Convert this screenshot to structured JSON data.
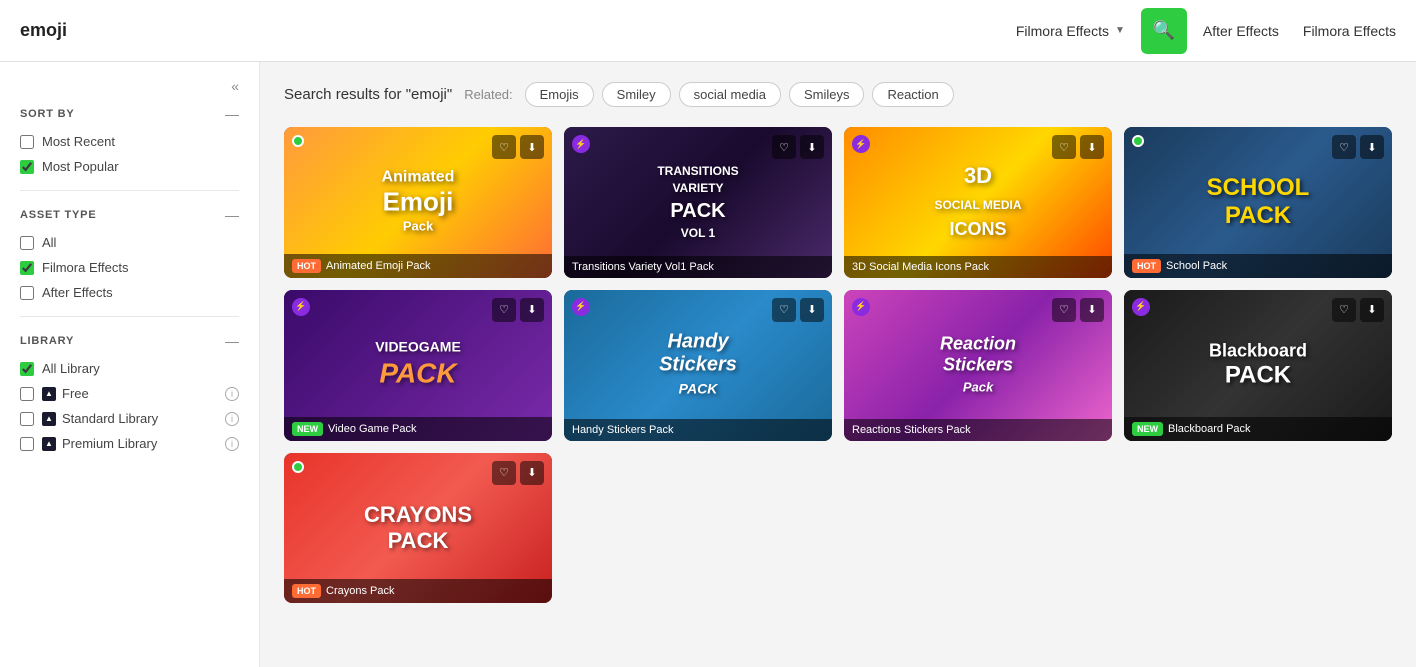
{
  "header": {
    "logo": "emoji",
    "dropdown_label": "Filmora Effects",
    "search_icon": "search",
    "nav_items": [
      {
        "label": "After Effects",
        "active": false
      },
      {
        "label": "Filmora Effects",
        "active": true
      }
    ]
  },
  "sidebar": {
    "collapse_icon": "«",
    "sort_by": {
      "title": "SORT BY",
      "options": [
        {
          "label": "Most Recent",
          "checked": false
        },
        {
          "label": "Most Popular",
          "checked": true
        }
      ]
    },
    "asset_type": {
      "title": "ASSET TYPE",
      "options": [
        {
          "label": "All",
          "checked": false
        },
        {
          "label": "Filmora Effects",
          "checked": true
        },
        {
          "label": "After Effects",
          "checked": false
        }
      ]
    },
    "library": {
      "title": "LIBRARY",
      "options": [
        {
          "label": "All Library",
          "checked": true,
          "has_shield": false,
          "has_info": false
        },
        {
          "label": "Free",
          "checked": false,
          "has_shield": true,
          "has_info": true
        },
        {
          "label": "Standard Library",
          "checked": false,
          "has_shield": true,
          "has_info": true
        },
        {
          "label": "Premium Library",
          "checked": false,
          "has_shield": true,
          "has_info": true
        }
      ]
    }
  },
  "main": {
    "search_results_text": "Search results for \"emoji\"",
    "related_label": "Related:",
    "related_tags": [
      "Emojis",
      "Smiley",
      "social media",
      "Smileys",
      "Reaction"
    ],
    "grid_items": [
      {
        "id": 1,
        "title": "Animated Emoji Pack",
        "badge": "HOT",
        "badge_type": "hot",
        "theme": "emoji",
        "indicator": "green",
        "overlay_text": "Animated\nEmoji\nPack"
      },
      {
        "id": 2,
        "title": "Transitions Variety Vol1 Pack",
        "badge": "",
        "badge_type": "none",
        "theme": "transitions",
        "indicator": "lightning",
        "overlay_text": "TRANSITIONS\nVARIETY\nPACK\nVOL 1"
      },
      {
        "id": 3,
        "title": "3D Social Media Icons Pack",
        "badge": "",
        "badge_type": "none",
        "theme": "3d",
        "indicator": "lightning",
        "overlay_text": "3D\nSOCIAL MEDIA\nICONS"
      },
      {
        "id": 4,
        "title": "School Pack",
        "badge": "HOT",
        "badge_type": "hot",
        "theme": "school",
        "indicator": "green",
        "overlay_text": "SCHOOL\nPACK"
      },
      {
        "id": 5,
        "title": "Video Game Pack",
        "badge": "NEW",
        "badge_type": "new",
        "theme": "videogame",
        "indicator": "lightning",
        "overlay_text": "VIDEOGAME\nPACK"
      },
      {
        "id": 6,
        "title": "Handy Stickers Pack",
        "badge": "",
        "badge_type": "none",
        "theme": "handy",
        "indicator": "lightning",
        "overlay_text": "Handy\nStickers\nPACK"
      },
      {
        "id": 7,
        "title": "Reactions Stickers Pack",
        "badge": "",
        "badge_type": "none",
        "theme": "reaction",
        "indicator": "lightning",
        "overlay_text": "Reaction\nStickers\nPack"
      },
      {
        "id": 8,
        "title": "Blackboard Pack",
        "badge": "NEW",
        "badge_type": "new",
        "theme": "blackboard",
        "indicator": "lightning",
        "overlay_text": "Blackboard\nPACK"
      },
      {
        "id": 9,
        "title": "Crayons Pack",
        "badge": "HOT",
        "badge_type": "hot",
        "theme": "crayons",
        "indicator": "green",
        "overlay_text": "CRAYONS\nPACK"
      }
    ]
  }
}
